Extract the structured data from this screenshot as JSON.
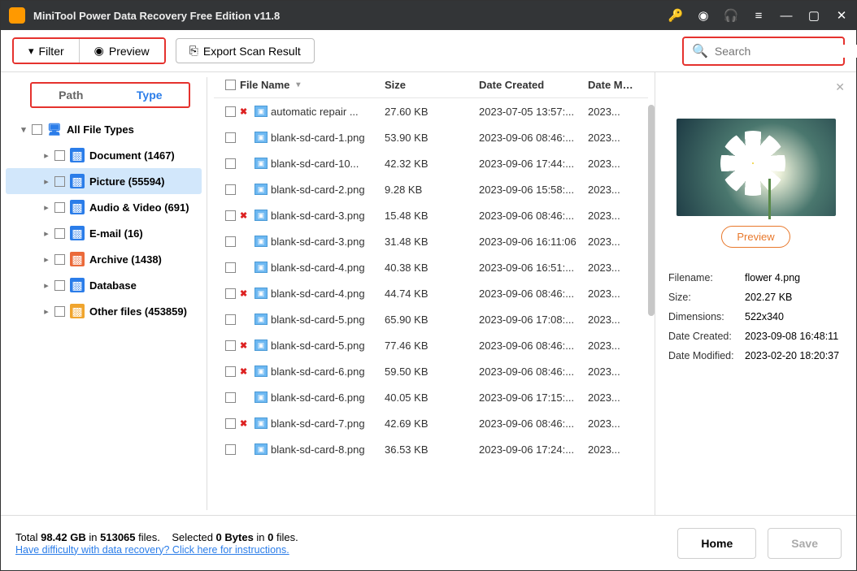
{
  "app": {
    "title": "MiniTool Power Data Recovery Free Edition v11.8"
  },
  "toolbar": {
    "filter": "Filter",
    "preview": "Preview",
    "export": "Export Scan Result",
    "search_placeholder": "Search"
  },
  "tabs": {
    "path": "Path",
    "type": "Type"
  },
  "tree": {
    "root": "All File Types",
    "items": [
      {
        "label": "Document (1467)",
        "color": "#2b7de9"
      },
      {
        "label": "Picture (55594)",
        "color": "#2b7de9"
      },
      {
        "label": "Audio & Video (691)",
        "color": "#2b7de9"
      },
      {
        "label": "E-mail (16)",
        "color": "#2b7de9"
      },
      {
        "label": "Archive (1438)",
        "color": "#eb6a3a"
      },
      {
        "label": "Database",
        "color": "#2b7de9"
      },
      {
        "label": "Other files (453859)",
        "color": "#f0a52e"
      }
    ]
  },
  "columns": {
    "name": "File Name",
    "size": "Size",
    "created": "Date Created",
    "modified": "Date Modif"
  },
  "files": [
    {
      "deleted": true,
      "name": "automatic repair ...",
      "size": "27.60 KB",
      "created": "2023-07-05 13:57:...",
      "modified": "2023..."
    },
    {
      "deleted": false,
      "name": "blank-sd-card-1.png",
      "size": "53.90 KB",
      "created": "2023-09-06 08:46:...",
      "modified": "2023..."
    },
    {
      "deleted": false,
      "name": "blank-sd-card-10...",
      "size": "42.32 KB",
      "created": "2023-09-06 17:44:...",
      "modified": "2023..."
    },
    {
      "deleted": false,
      "name": "blank-sd-card-2.png",
      "size": "9.28 KB",
      "created": "2023-09-06 15:58:...",
      "modified": "2023..."
    },
    {
      "deleted": true,
      "name": "blank-sd-card-3.png",
      "size": "15.48 KB",
      "created": "2023-09-06 08:46:...",
      "modified": "2023..."
    },
    {
      "deleted": false,
      "name": "blank-sd-card-3.png",
      "size": "31.48 KB",
      "created": "2023-09-06 16:11:06",
      "modified": "2023..."
    },
    {
      "deleted": false,
      "name": "blank-sd-card-4.png",
      "size": "40.38 KB",
      "created": "2023-09-06 16:51:...",
      "modified": "2023..."
    },
    {
      "deleted": true,
      "name": "blank-sd-card-4.png",
      "size": "44.74 KB",
      "created": "2023-09-06 08:46:...",
      "modified": "2023..."
    },
    {
      "deleted": false,
      "name": "blank-sd-card-5.png",
      "size": "65.90 KB",
      "created": "2023-09-06 17:08:...",
      "modified": "2023..."
    },
    {
      "deleted": true,
      "name": "blank-sd-card-5.png",
      "size": "77.46 KB",
      "created": "2023-09-06 08:46:...",
      "modified": "2023..."
    },
    {
      "deleted": true,
      "name": "blank-sd-card-6.png",
      "size": "59.50 KB",
      "created": "2023-09-06 08:46:...",
      "modified": "2023..."
    },
    {
      "deleted": false,
      "name": "blank-sd-card-6.png",
      "size": "40.05 KB",
      "created": "2023-09-06 17:15:...",
      "modified": "2023..."
    },
    {
      "deleted": true,
      "name": "blank-sd-card-7.png",
      "size": "42.69 KB",
      "created": "2023-09-06 08:46:...",
      "modified": "2023..."
    },
    {
      "deleted": false,
      "name": "blank-sd-card-8.png",
      "size": "36.53 KB",
      "created": "2023-09-06 17:24:...",
      "modified": "2023..."
    }
  ],
  "preview": {
    "button": "Preview",
    "labels": {
      "filename": "Filename:",
      "size": "Size:",
      "dimensions": "Dimensions:",
      "created": "Date Created:",
      "modified": "Date Modified:"
    },
    "values": {
      "filename": "flower 4.png",
      "size": "202.27 KB",
      "dimensions": "522x340",
      "created": "2023-09-08 16:48:11",
      "modified": "2023-02-20 18:20:37"
    }
  },
  "footer": {
    "total_label": "Total",
    "total_size": "98.42 GB",
    "in1": "in",
    "total_files": "513065",
    "files1": "files.",
    "sel_label": "Selected",
    "sel_bytes": "0 Bytes",
    "in2": "in",
    "sel_files": "0",
    "files2": "files.",
    "help": "Have difficulty with data recovery? Click here for instructions.",
    "home": "Home",
    "save": "Save"
  }
}
